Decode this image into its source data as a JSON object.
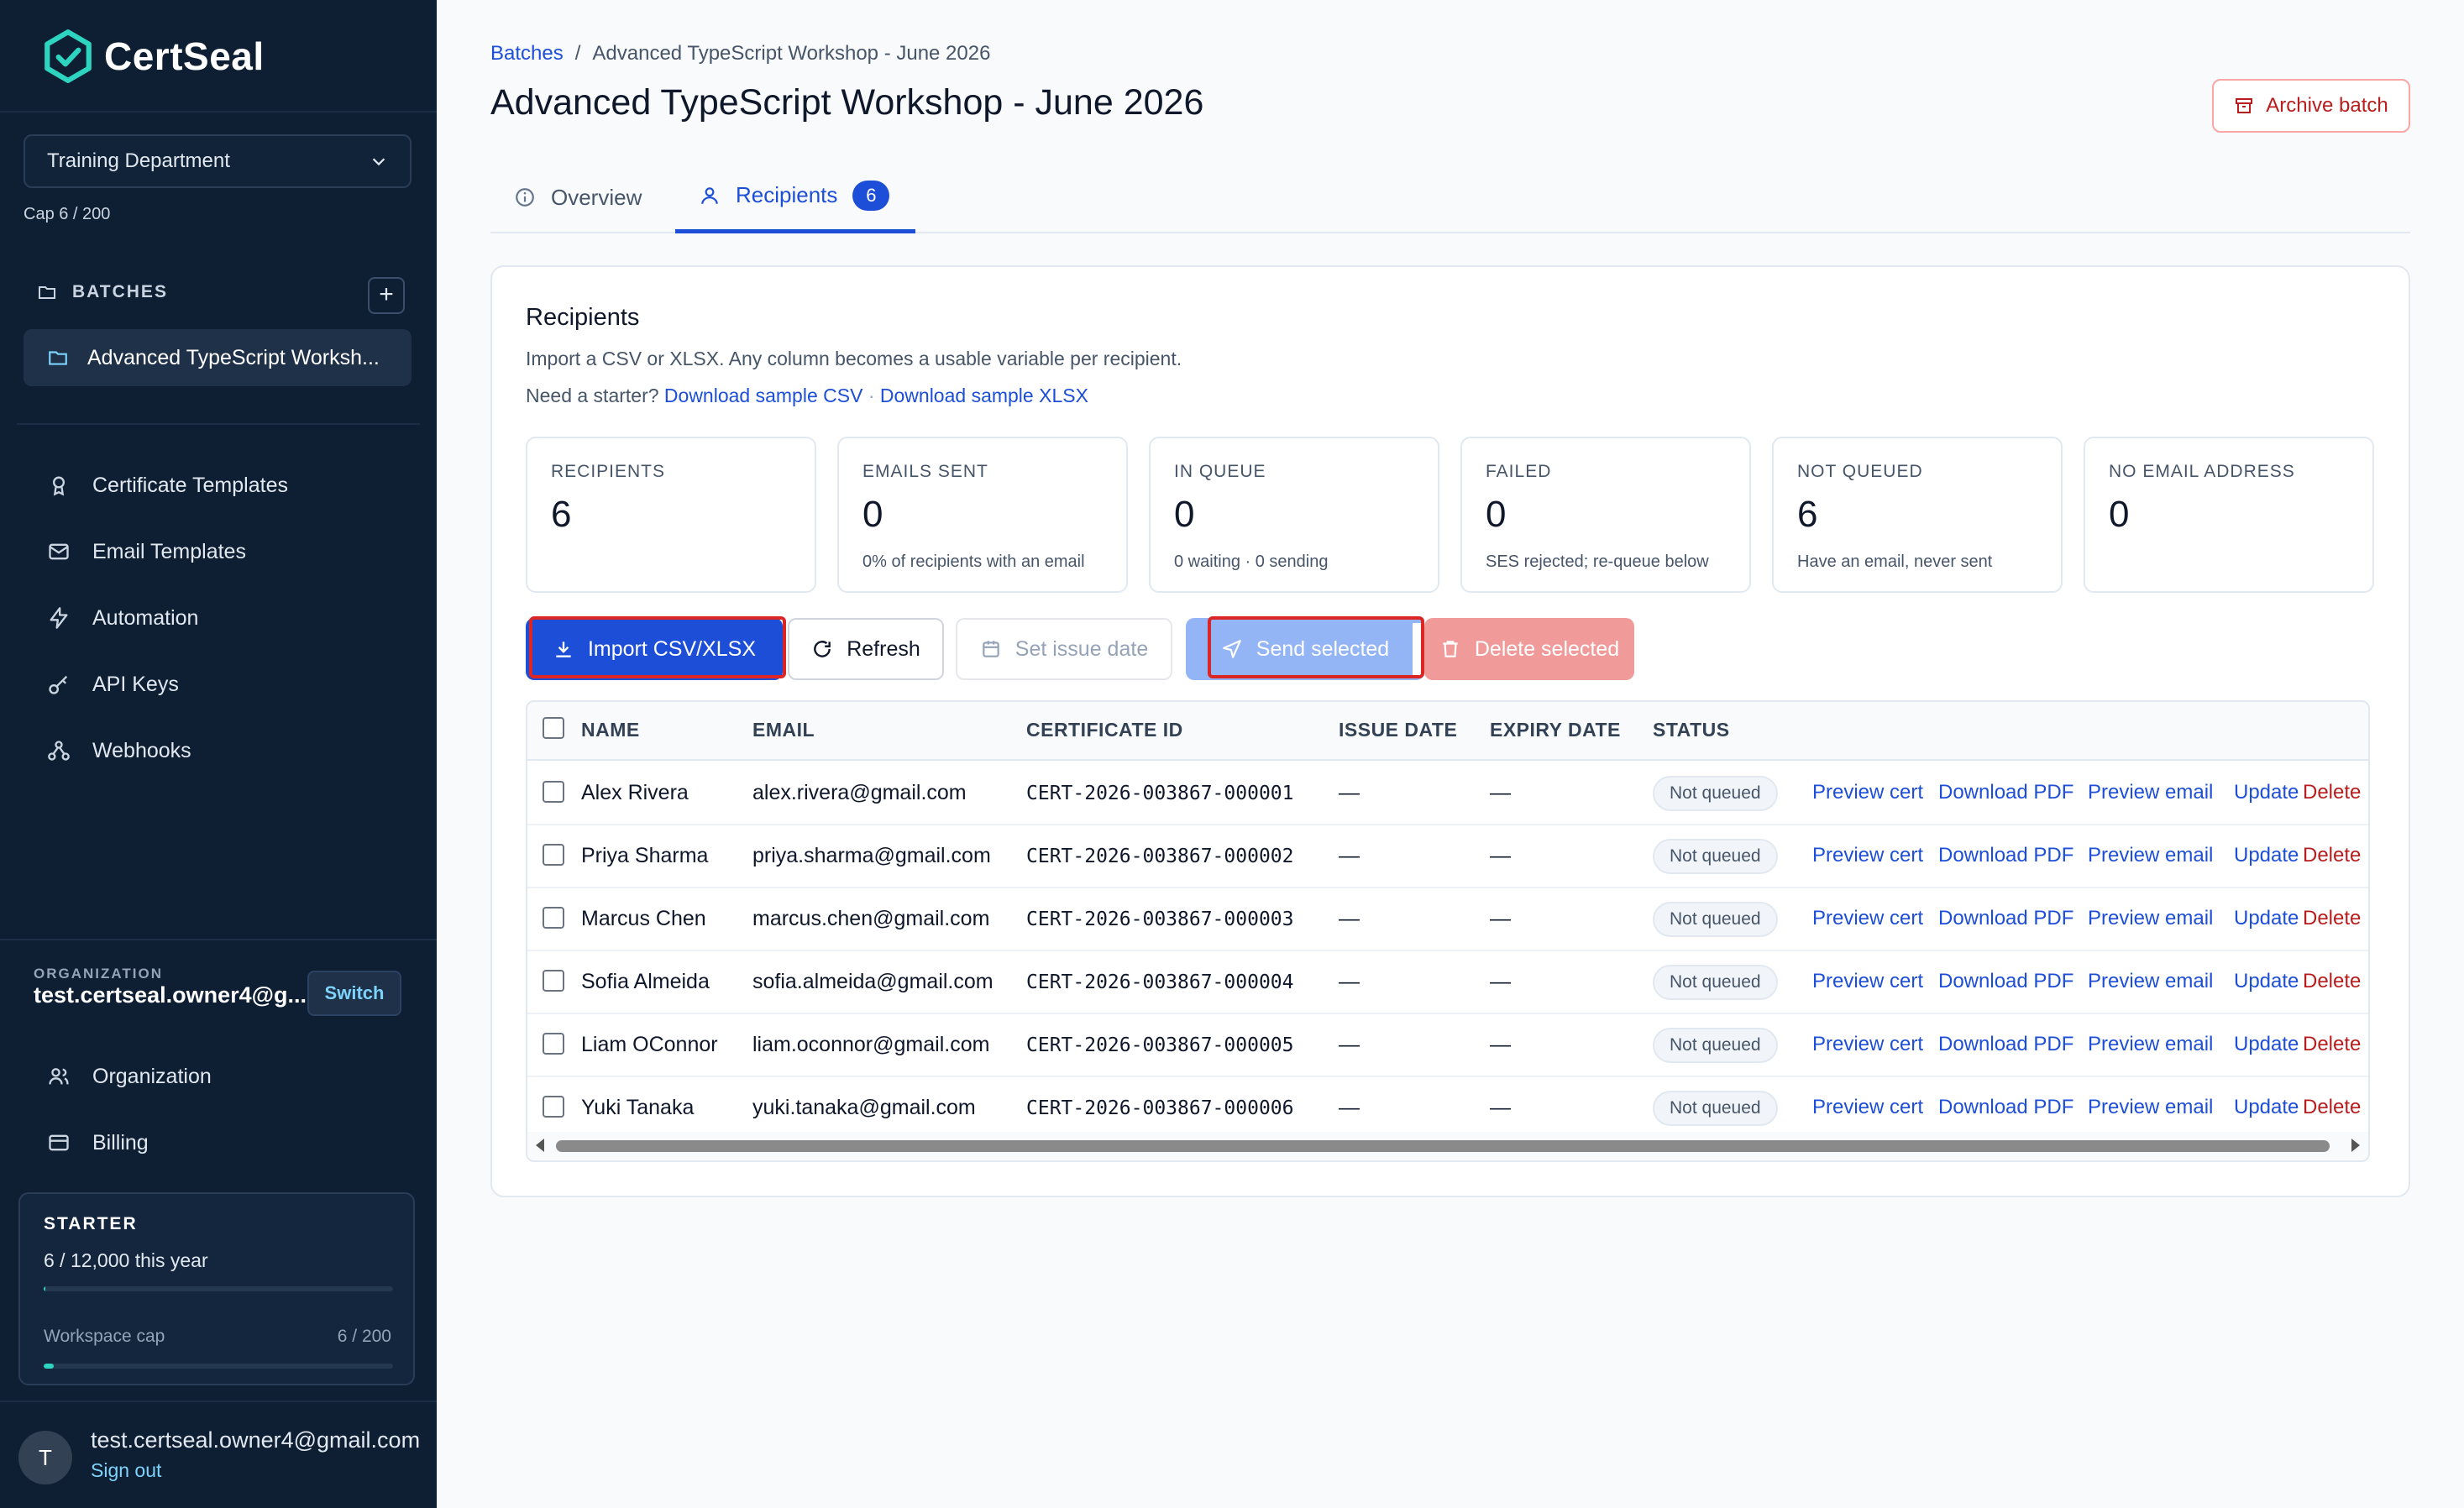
{
  "app": {
    "name": "CertSeal"
  },
  "sidebar": {
    "department": "Training Department",
    "cap": "Cap 6 / 200",
    "batches_label": "BATCHES",
    "batch_item": "Advanced TypeScript Worksh...",
    "nav": [
      {
        "label": "Certificate Templates",
        "icon": "award-icon"
      },
      {
        "label": "Email Templates",
        "icon": "mail-icon"
      },
      {
        "label": "Automation",
        "icon": "bolt-icon"
      },
      {
        "label": "API Keys",
        "icon": "key-icon"
      },
      {
        "label": "Webhooks",
        "icon": "webhook-icon"
      }
    ],
    "organization_label": "ORGANIZATION",
    "organization_email": "test.certseal.owner4@g...",
    "switch_label": "Switch",
    "org_nav": [
      {
        "label": "Organization",
        "icon": "users-icon"
      },
      {
        "label": "Billing",
        "icon": "credit-card-icon"
      }
    ],
    "plan": {
      "name": "STARTER",
      "usage": "6 / 12,000 this year",
      "usage_fraction": 0.0005,
      "workspace_label": "Workspace cap",
      "workspace_value": "6 / 200",
      "workspace_fraction": 0.03
    },
    "user": {
      "initial": "T",
      "email": "test.certseal.owner4@gmail.com",
      "sign_out": "Sign out"
    }
  },
  "header": {
    "breadcrumb_root": "Batches",
    "breadcrumb_sep": "/",
    "breadcrumb_current": "Advanced TypeScript Workshop - June 2026",
    "title": "Advanced TypeScript Workshop - June 2026",
    "archive_label": "Archive batch"
  },
  "tabs": {
    "overview": "Overview",
    "recipients": "Recipients",
    "recipients_count": "6"
  },
  "recipients": {
    "title": "Recipients",
    "description": "Import a CSV or XLSX. Any column becomes a usable variable per recipient.",
    "starter_prefix": "Need a starter?",
    "sample_csv": "Download sample CSV",
    "sample_sep": "·",
    "sample_xlsx": "Download sample XLSX",
    "stats": [
      {
        "label": "RECIPIENTS",
        "value": "6",
        "sub": ""
      },
      {
        "label": "EMAILS SENT",
        "value": "0",
        "sub": "0% of recipients with an email"
      },
      {
        "label": "IN QUEUE",
        "value": "0",
        "sub": "0 waiting · 0 sending"
      },
      {
        "label": "FAILED",
        "value": "0",
        "sub": "SES rejected; re-queue below"
      },
      {
        "label": "NOT QUEUED",
        "value": "6",
        "sub": "Have an email, never sent"
      },
      {
        "label": "NO EMAIL ADDRESS",
        "value": "0",
        "sub": ""
      }
    ],
    "actions": {
      "import": "Import CSV/XLSX",
      "refresh": "Refresh",
      "set_issue_date": "Set issue date",
      "send_selected": "Send selected",
      "delete_selected": "Delete selected"
    },
    "columns": [
      "NAME",
      "EMAIL",
      "CERTIFICATE ID",
      "ISSUE DATE",
      "EXPIRY DATE",
      "STATUS"
    ],
    "row_actions": [
      "Preview cert",
      "Download PDF",
      "Preview email",
      "Update",
      "Delete"
    ],
    "rows": [
      {
        "name": "Alex Rivera",
        "email": "alex.rivera@gmail.com",
        "cert_id": "CERT-2026-003867-000001",
        "issue": "—",
        "expiry": "—",
        "status": "Not queued"
      },
      {
        "name": "Priya Sharma",
        "email": "priya.sharma@gmail.com",
        "cert_id": "CERT-2026-003867-000002",
        "issue": "—",
        "expiry": "—",
        "status": "Not queued"
      },
      {
        "name": "Marcus Chen",
        "email": "marcus.chen@gmail.com",
        "cert_id": "CERT-2026-003867-000003",
        "issue": "—",
        "expiry": "—",
        "status": "Not queued"
      },
      {
        "name": "Sofia Almeida",
        "email": "sofia.almeida@gmail.com",
        "cert_id": "CERT-2026-003867-000004",
        "issue": "—",
        "expiry": "—",
        "status": "Not queued"
      },
      {
        "name": "Liam OConnor",
        "email": "liam.oconnor@gmail.com",
        "cert_id": "CERT-2026-003867-000005",
        "issue": "—",
        "expiry": "—",
        "status": "Not queued"
      },
      {
        "name": "Yuki Tanaka",
        "email": "yuki.tanaka@gmail.com",
        "cert_id": "CERT-2026-003867-000006",
        "issue": "—",
        "expiry": "—",
        "status": "Not queued"
      }
    ]
  },
  "colors": {
    "sidebar_bg": "#0f1f33",
    "accent": "#1d4ed8",
    "danger": "#b91c1c",
    "teal": "#2dd4bf",
    "highlight": "#dc2626"
  }
}
